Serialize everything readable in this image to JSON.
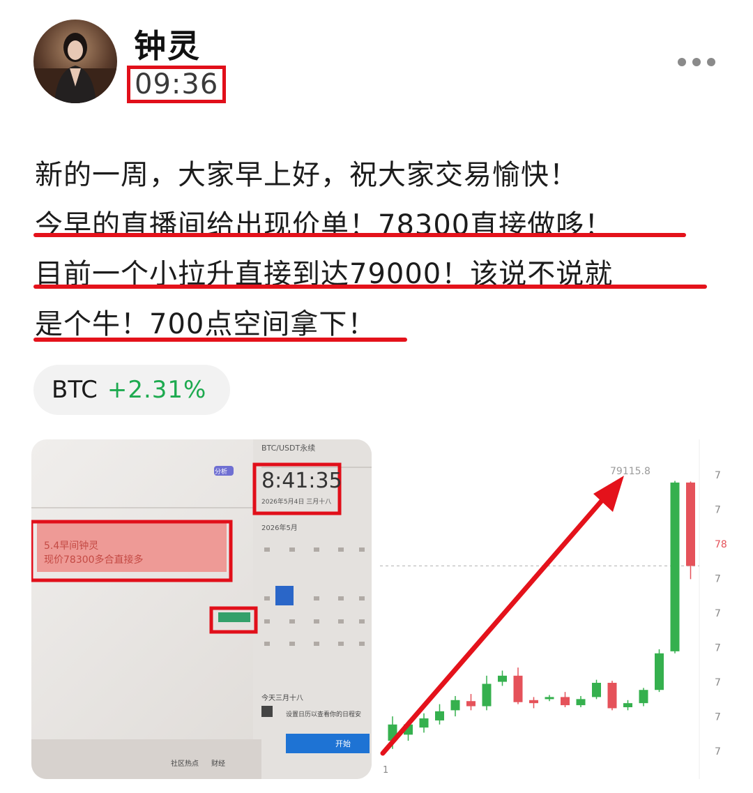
{
  "post": {
    "author": "钟灵",
    "time": "09:36",
    "lines": [
      "新的一周，大家早上好，祝大家交易愉快！",
      "今早的直播间给出现价单！78300直接做哆！",
      "目前一个小拉升直接到达79000！该说不说就",
      "是个牛！700点空间拿下！"
    ]
  },
  "ticker": {
    "symbol": "BTC",
    "change": "+2.31%"
  },
  "photo": {
    "title": "BTC/USDT永续",
    "clock": "8:41:35",
    "date_line": "2026年5月4日 三月十八",
    "month_title": "2026年5月",
    "today_label": "今天三月十八",
    "schedule_text": "设置日历以查看你的日程安",
    "start_button": "开始",
    "tag": "分析",
    "note_line1": "5.4早间钟灵",
    "note_line2": "现价78300多合直接多",
    "taskbar_items": [
      "社区热点",
      "财经"
    ]
  },
  "chart_data": {
    "type": "candlestick",
    "annotation": "79115.8",
    "x_tick": "1",
    "right_axis_labels": [
      "7",
      "7",
      "78",
      "7",
      "7",
      "7",
      "7",
      "7",
      "7"
    ],
    "candles": [
      {
        "o": 76560,
        "c": 76720,
        "h": 76800,
        "l": 76480
      },
      {
        "o": 76620,
        "c": 76720,
        "h": 76760,
        "l": 76560
      },
      {
        "o": 76690,
        "c": 76780,
        "h": 76830,
        "l": 76640
      },
      {
        "o": 76760,
        "c": 76850,
        "h": 76920,
        "l": 76720
      },
      {
        "o": 76860,
        "c": 76960,
        "h": 77000,
        "l": 76800
      },
      {
        "o": 76950,
        "c": 76900,
        "h": 77020,
        "l": 76860
      },
      {
        "o": 76900,
        "c": 77120,
        "h": 77200,
        "l": 76860
      },
      {
        "o": 77140,
        "c": 77200,
        "h": 77250,
        "l": 77100
      },
      {
        "o": 77200,
        "c": 76940,
        "h": 77280,
        "l": 76920
      },
      {
        "o": 76960,
        "c": 76930,
        "h": 76990,
        "l": 76880
      },
      {
        "o": 76970,
        "c": 76990,
        "h": 77010,
        "l": 76950
      },
      {
        "o": 76990,
        "c": 76910,
        "h": 77040,
        "l": 76890
      },
      {
        "o": 76910,
        "c": 76970,
        "h": 77000,
        "l": 76890
      },
      {
        "o": 76990,
        "c": 77130,
        "h": 77160,
        "l": 76970
      },
      {
        "o": 77130,
        "c": 76880,
        "h": 77150,
        "l": 76860
      },
      {
        "o": 76890,
        "c": 76930,
        "h": 76960,
        "l": 76860
      },
      {
        "o": 76930,
        "c": 77060,
        "h": 77080,
        "l": 76900
      },
      {
        "o": 77060,
        "c": 77420,
        "h": 77460,
        "l": 77040
      },
      {
        "o": 77440,
        "c": 79100,
        "h": 79115.8,
        "l": 77420
      },
      {
        "o": 79100,
        "c": 78280,
        "h": 79110,
        "l": 78150
      }
    ],
    "current_price": 78280
  },
  "colors": {
    "up": "#35b04e",
    "down": "#e5525a",
    "accent": "#e10f1a",
    "positive": "#1daa4f"
  },
  "icons": {
    "more": "more-dots-icon",
    "avatar": "avatar"
  }
}
